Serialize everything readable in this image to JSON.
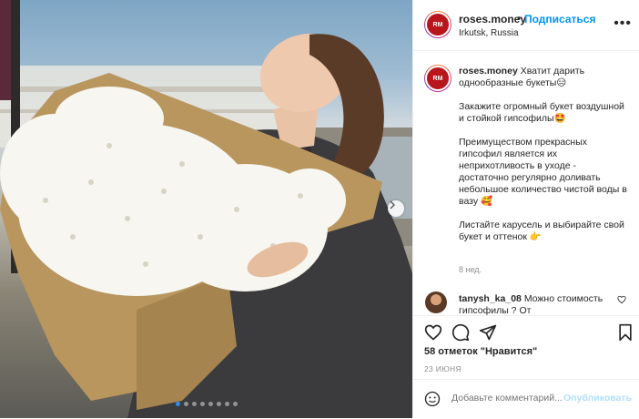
{
  "post": {
    "image_alt": "",
    "carousel": {
      "count": 8,
      "active": 0
    }
  },
  "header": {
    "username": "roses.money",
    "separator": "•",
    "follow_label": "Подписаться",
    "location": "Irkutsk, Russia",
    "more_label": "•••",
    "avatar_text": "RM"
  },
  "caption": {
    "username": "roses.money",
    "line1": "Хватит дарить однообразные букеты😑",
    "para2": "Закажите огромный букет воздушной и стойкой гипсофилы🤩",
    "para3": "Преимуществом прекрасных гипсофил является их неприхотливость в уходе - достаточно регулярно доливать небольшое количество чистой воды в вазу 🥰",
    "para4": "Листайте карусель и выбирайте свой букет и оттенок 👉",
    "time_ago": "8 нед."
  },
  "comment": {
    "username": "tanysh_ka_08",
    "text": "Можно стоимость гипсофилы ? От"
  },
  "stats": {
    "likes": "58 отметок \"Нравится\"",
    "date": "23 ИЮНЯ"
  },
  "add_comment": {
    "placeholder": "Добавьте комментарий...",
    "post_label": "Опубликовать"
  },
  "icons": [
    "heart-icon",
    "comment-icon",
    "share-icon",
    "bookmark-icon",
    "emoji-icon",
    "chevron-right-icon",
    "more-icon"
  ],
  "colors": {
    "accent": "#0095f6",
    "post_disabled": "#b2dffc",
    "muted": "#8e8e8e",
    "border": "#efefef"
  }
}
